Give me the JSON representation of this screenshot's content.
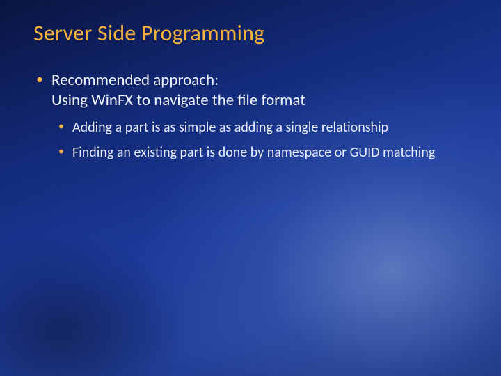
{
  "slide": {
    "title": "Server Side Programming",
    "bullets": [
      {
        "line1": "Recommended approach:",
        "line2": "Using WinFX to navigate the file format",
        "sub": [
          "Adding a part is as simple as adding a single relationship",
          "Finding an existing part is done by namespace or GUID matching"
        ]
      }
    ]
  },
  "colors": {
    "accent": "#f4b13e",
    "text": "#eef2ff"
  }
}
